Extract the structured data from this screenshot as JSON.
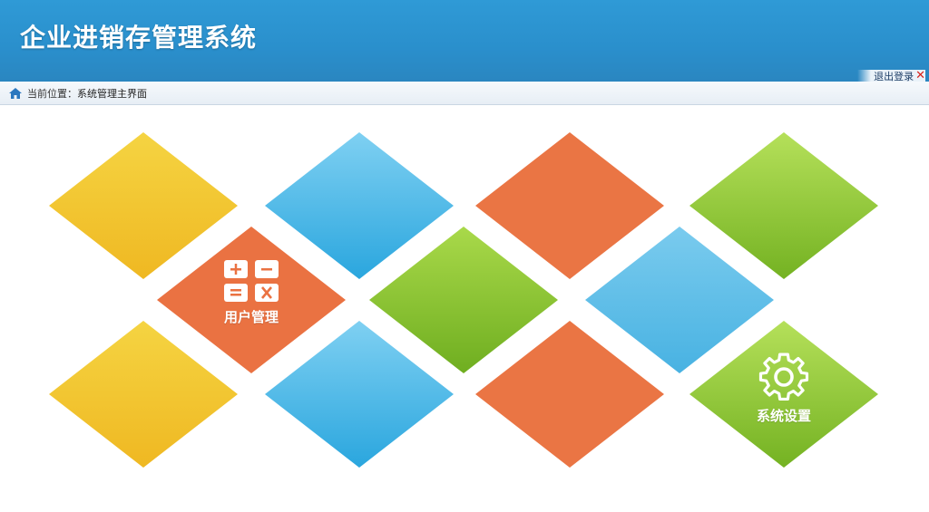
{
  "header": {
    "title": "企业进销存管理系统",
    "logout_label": "退出登录",
    "logout_icon": "close-icon"
  },
  "breadcrumb": {
    "prefix": "当前位置：",
    "current": "系统管理主界面"
  },
  "colors": {
    "header_blue": "#2a8fcc",
    "yellow": "#f0c22a",
    "blue": "#4db6e3",
    "orange": "#ea7745",
    "green": "#8cc63f"
  },
  "tiles": {
    "user_management": {
      "label": "用户管理",
      "icon": "calculator-icon"
    },
    "system_settings": {
      "label": "系统设置",
      "icon": "gear-icon"
    }
  }
}
